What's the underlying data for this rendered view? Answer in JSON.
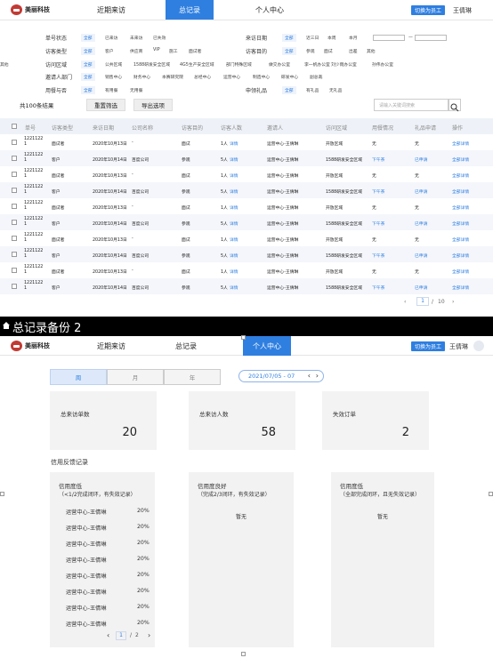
{
  "screen1": {
    "app": {
      "logo": "美丽科技",
      "nav": [
        "近期来访",
        "总记录",
        "个人中心"
      ],
      "active_nav": 1,
      "switch_btn": "切换为员工",
      "user": "王倩琳"
    },
    "filters": {
      "left": [
        {
          "label": "单号状态",
          "options": [
            "全部",
            "已来访",
            "未来访",
            "已失效"
          ]
        },
        {
          "label": "访客类型",
          "options": [
            "全部",
            "客户",
            "供应商",
            "VIP",
            "施工",
            "面试者"
          ]
        },
        {
          "label": "访问区域",
          "options": [
            "全部",
            "公共区域",
            "1588研发安全区域",
            "4G5生产安全区域",
            "部门特殊区域",
            "做交办公室",
            "李一帆办公室",
            "刘少雨办公室",
            "孙伟办公室",
            "其他"
          ]
        },
        {
          "label": "邀请人部门",
          "options": [
            "全部",
            "销售中心",
            "财务中心",
            "本赛研究院",
            "总经中心",
            "运营中心",
            "制造中心",
            "研发中心",
            "副总裁"
          ]
        },
        {
          "label": "用餐与否",
          "options": [
            "全部",
            "有用餐",
            "无用餐"
          ]
        }
      ],
      "right": [
        {
          "label": "来访日期",
          "options": [
            "全部",
            "近三日",
            "本周",
            "本月"
          ]
        },
        {
          "label": "访客目的",
          "options": [
            "全部",
            "参观",
            "面试",
            "出差",
            "其他"
          ]
        },
        {
          "label": "申领礼品",
          "options": [
            "全部",
            "有礼品",
            "无礼品"
          ]
        }
      ],
      "date_sep": "—"
    },
    "result_text": "共100条结果",
    "btn_reset": "重置筛选",
    "btn_export": "导出选项",
    "search_placeholder": "请输入关键词搜索",
    "columns": [
      "单号",
      "访客类型",
      "来访日期",
      "公司名称",
      "访客目的",
      "访客人数",
      "邀请人",
      "访问区域",
      "用餐情况",
      "礼品申请",
      "操作"
    ],
    "rows": [
      {
        "no": "1221122 1",
        "type": "面试者",
        "date": "2020年10月13日",
        "company": "-",
        "purpose": "面试",
        "count": "1人",
        "inviter": "运营中心-王倩琳",
        "area": "开放区域",
        "meal": "无",
        "gift": "无",
        "detail": "详情",
        "op": "全部详情",
        "meal_link": false,
        "gift_link": false
      },
      {
        "no": "1221122 1",
        "type": "客户",
        "date": "2020年10月14日",
        "company": "百度公司",
        "purpose": "参观",
        "count": "5人",
        "inviter": "运营中心-王倩琳",
        "area": "1588研发安全区域",
        "meal": "下午茶",
        "gift": "已申请",
        "detail": "详情",
        "op": "全部详情",
        "meal_link": true,
        "gift_link": true
      },
      {
        "no": "1221122 1",
        "type": "面试者",
        "date": "2020年10月13日",
        "company": "-",
        "purpose": "面试",
        "count": "1人",
        "inviter": "运营中心-王倩琳",
        "area": "开放区域",
        "meal": "无",
        "gift": "无",
        "detail": "详情",
        "op": "全部详情",
        "meal_link": false,
        "gift_link": false
      },
      {
        "no": "1221122 1",
        "type": "客户",
        "date": "2020年10月14日",
        "company": "百度公司",
        "purpose": "参观",
        "count": "5人",
        "inviter": "运营中心-王倩琳",
        "area": "1588研发安全区域",
        "meal": "下午茶",
        "gift": "已申请",
        "detail": "详情",
        "op": "全部详情",
        "meal_link": true,
        "gift_link": true
      },
      {
        "no": "1221122 1",
        "type": "面试者",
        "date": "2020年10月13日",
        "company": "-",
        "purpose": "面试",
        "count": "1人",
        "inviter": "运营中心-王倩琳",
        "area": "开放区域",
        "meal": "无",
        "gift": "无",
        "detail": "详情",
        "op": "全部详情",
        "meal_link": false,
        "gift_link": false
      },
      {
        "no": "1221122 1",
        "type": "客户",
        "date": "2020年10月14日",
        "company": "百度公司",
        "purpose": "参观",
        "count": "5人",
        "inviter": "运营中心-王倩琳",
        "area": "1588研发安全区域",
        "meal": "下午茶",
        "gift": "已申请",
        "detail": "详情",
        "op": "全部详情",
        "meal_link": true,
        "gift_link": true
      },
      {
        "no": "1221122 1",
        "type": "面试者",
        "date": "2020年10月13日",
        "company": "-",
        "purpose": "面试",
        "count": "1人",
        "inviter": "运营中心-王倩琳",
        "area": "开放区域",
        "meal": "无",
        "gift": "无",
        "detail": "详情",
        "op": "全部详情",
        "meal_link": false,
        "gift_link": false
      },
      {
        "no": "1221122 1",
        "type": "客户",
        "date": "2020年10月14日",
        "company": "百度公司",
        "purpose": "参观",
        "count": "5人",
        "inviter": "运营中心-王倩琳",
        "area": "1588研发安全区域",
        "meal": "下午茶",
        "gift": "已申请",
        "detail": "详情",
        "op": "全部详情",
        "meal_link": true,
        "gift_link": true
      },
      {
        "no": "1221122 1",
        "type": "面试者",
        "date": "2020年10月13日",
        "company": "-",
        "purpose": "面试",
        "count": "1人",
        "inviter": "运营中心-王倩琳",
        "area": "开放区域",
        "meal": "无",
        "gift": "无",
        "detail": "详情",
        "op": "全部详情",
        "meal_link": false,
        "gift_link": false
      },
      {
        "no": "1221122 1",
        "type": "客户",
        "date": "2020年10月14日",
        "company": "百度公司",
        "purpose": "参观",
        "count": "5人",
        "inviter": "运营中心-王倩琳",
        "area": "1588研发安全区域",
        "meal": "下午茶",
        "gift": "已申请",
        "detail": "详情",
        "op": "全部详情",
        "meal_link": true,
        "gift_link": true
      }
    ],
    "pager": {
      "current": "1",
      "total": "10",
      "sep": "/"
    }
  },
  "divider_title": "总记录备份 2",
  "screen2": {
    "app": {
      "logo": "美丽科技",
      "nav": [
        "近期来访",
        "总记录",
        "个人中心"
      ],
      "active_nav": 2,
      "switch_btn": "切换为员工",
      "user": "王倩琳"
    },
    "segments": [
      "周",
      "月",
      "年"
    ],
    "active_segment": 0,
    "date_range": "2021/07/05 - 07",
    "stats": [
      {
        "label": "总来访单数",
        "value": "20"
      },
      {
        "label": "总来访人数",
        "value": "58"
      },
      {
        "label": "失效订单",
        "value": "2"
      }
    ],
    "section_title": "信用反馈记录",
    "panels": [
      {
        "title": "信用度低",
        "subtitle": "（<1/2完成闭环，有失效记录）"
      },
      {
        "title": "信用度良好",
        "subtitle": "（完成2/3闭环，有失效记录）",
        "empty": "暂无"
      },
      {
        "title": "信用度低",
        "subtitle": "（全部完成闭环，且无失效记录）",
        "empty": "暂无"
      }
    ],
    "list": [
      {
        "name": "运营中心-王倩琳",
        "pct": "20%"
      },
      {
        "name": "运营中心-王倩琳",
        "pct": "20%"
      },
      {
        "name": "运营中心-王倩琳",
        "pct": "20%"
      },
      {
        "name": "运营中心-王倩琳",
        "pct": "20%"
      },
      {
        "name": "运营中心-王倩琳",
        "pct": "20%"
      },
      {
        "name": "运营中心-王倩琳",
        "pct": "20%"
      },
      {
        "name": "运营中心-王倩琳",
        "pct": "20%"
      },
      {
        "name": "运营中心-王倩琳",
        "pct": "20%"
      }
    ],
    "pager": {
      "current": "1",
      "total": "2",
      "sep": "/"
    }
  }
}
